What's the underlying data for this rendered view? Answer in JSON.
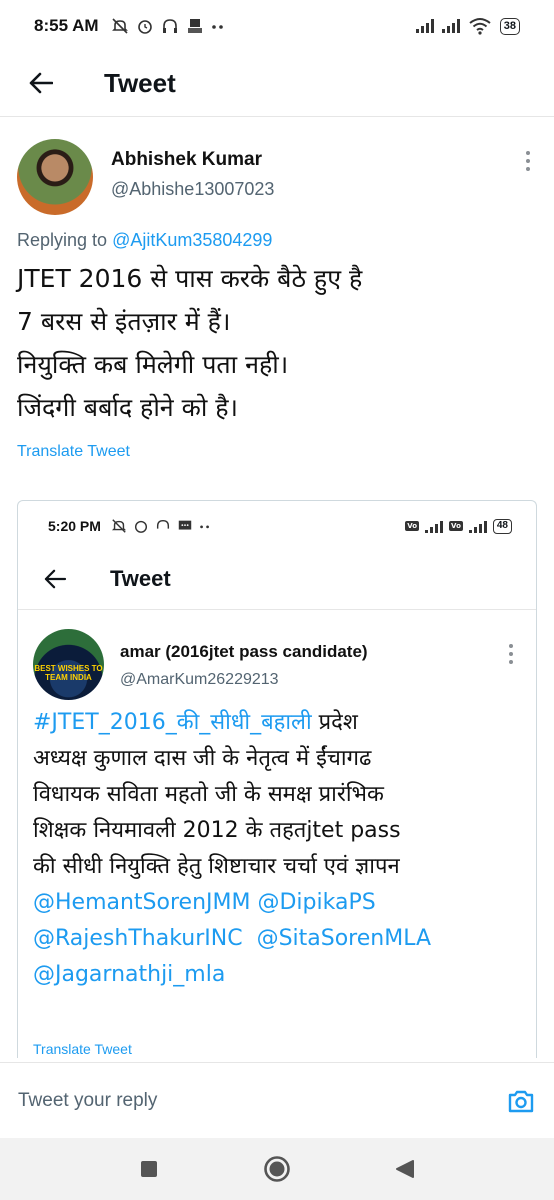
{
  "status_bar": {
    "time": "8:55 AM",
    "battery": "38"
  },
  "header": {
    "title": "Tweet"
  },
  "tweet": {
    "author_name": "Abhishek Kumar",
    "author_handle": "@Abhishe13007023",
    "replying_prefix": "Replying to ",
    "replying_handle": "@AjitKum35804299",
    "lines": [
      "JTET 2016 से पास करके बैठे हुए है",
      "7 बरस से इंतज़ार में हैं।",
      "नियुक्ति कब मिलेगी पता नही।",
      "जिंदगी बर्बाद होने को है।"
    ],
    "translate_label": "Translate Tweet"
  },
  "quoted_screenshot": {
    "status_time": "5:20 PM",
    "battery": "48",
    "header_title": "Tweet",
    "author_name": "amar (2016jtet pass candidate)",
    "author_handle": "@AmarKum26229213",
    "avatar_text": "BEST WISHES TO TEAM INDIA",
    "line1_hashtag": "#JTET_2016_की_सीधी_बहाली",
    "line1_rest": " प्रदेश",
    "line2": "अध्यक्ष  कुणाल दास जी के नेतृत्व में ईंचागढ",
    "line3": "विधायक सविता महतो जी  के समक्ष प्रारंभिक",
    "line4": "शिक्षक नियमावली 2012 के तहतjtet pass",
    "line5": "की सीधी नियुक्ति हेतु  शिष्टाचार चर्चा एवं ज्ञापन",
    "mention1": "@HemantSorenJMM",
    "mention2": "@DipikaPS",
    "mention3": "@RajeshThakurINC",
    "mention4": "@SitaSorenMLA",
    "mention5": "@Jagarnathji_mla",
    "translate_label": "Translate Tweet"
  },
  "reply": {
    "placeholder": "Tweet your reply"
  },
  "icons": {
    "back": "back-arrow-icon",
    "more": "more-vertical-icon",
    "camera": "camera-icon",
    "nav_recents": "square-recents-icon",
    "nav_home": "circle-home-icon",
    "nav_back": "triangle-back-icon"
  },
  "colors": {
    "link": "#1d9bf0",
    "text": "#0f1419",
    "muted": "#536471"
  }
}
